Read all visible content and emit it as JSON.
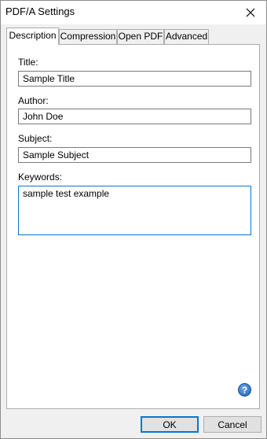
{
  "window": {
    "title": "PDF/A Settings"
  },
  "tabs": [
    {
      "label": "Description",
      "active": true
    },
    {
      "label": "Compression",
      "active": false
    },
    {
      "label": "Open PDF",
      "active": false
    },
    {
      "label": "Advanced",
      "active": false
    }
  ],
  "form": {
    "title_label": "Title:",
    "title_value": "Sample Title",
    "author_label": "Author:",
    "author_value": "John Doe",
    "subject_label": "Subject:",
    "subject_value": "Sample Subject",
    "keywords_label": "Keywords:",
    "keywords_value": "sample test example"
  },
  "help": {
    "glyph": "?"
  },
  "buttons": {
    "ok_label": "OK",
    "cancel_label": "Cancel"
  },
  "colors": {
    "focus_accent": "#0078d7",
    "help_icon": "#1f5fb5"
  }
}
